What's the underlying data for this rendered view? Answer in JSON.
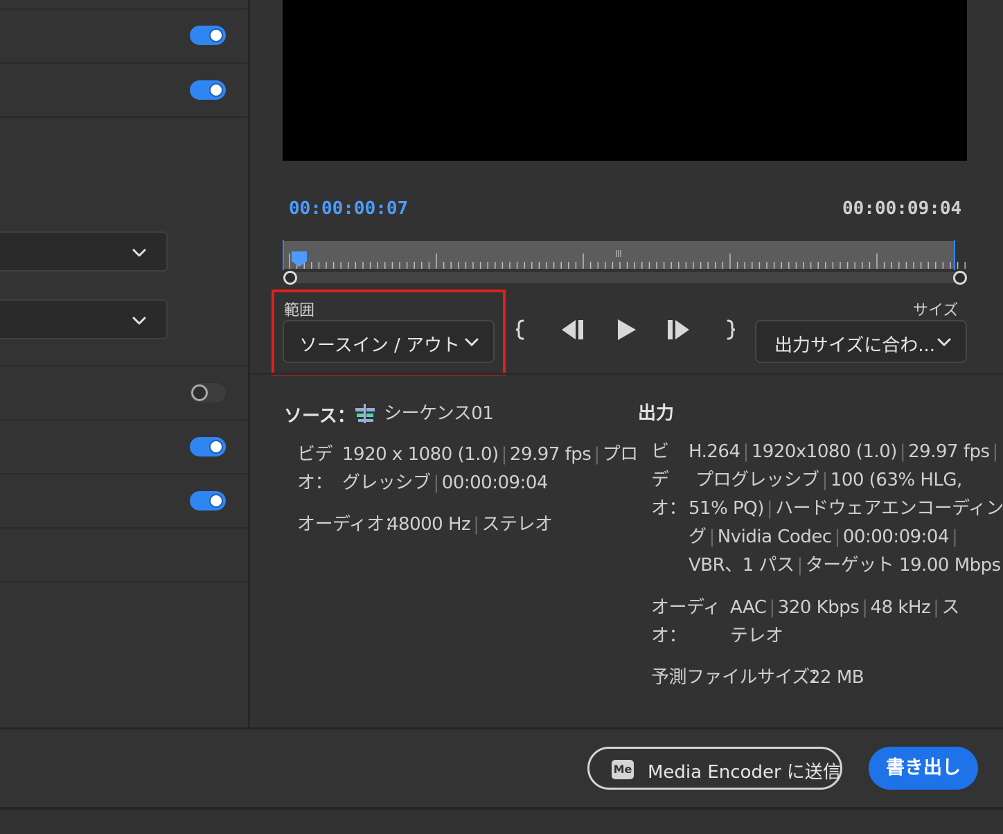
{
  "left_panel": {
    "toggles": [
      {
        "state": "on"
      },
      {
        "state": "on"
      },
      {
        "state": "off"
      },
      {
        "state": "on"
      },
      {
        "state": "on"
      }
    ]
  },
  "preview": {
    "current_timecode": "00:00:00:07",
    "duration_timecode": "00:00:09:04"
  },
  "range": {
    "label": "範囲",
    "selected": "ソースイン / アウト"
  },
  "size": {
    "label": "サイズ",
    "selected": "出力サイズに合わ..."
  },
  "source": {
    "title": "ソース：",
    "sequence_icon": "sequence-icon",
    "sequence_name": "シーケンス01",
    "video_label_line1": "ビデ",
    "video_label_line2": "オ：",
    "video_line1": "1920 x 1080 (1.0)",
    "video_line1b": "29.97 fps",
    "video_line1c": "プロ",
    "video_line2": "グレッシブ",
    "video_line2b": "00:00:09:04",
    "audio_label": "オーディオ：",
    "audio_value": "48000 Hz",
    "audio_value2": "ステレオ"
  },
  "output": {
    "title": "出力",
    "video_label_1": "ビ",
    "video_label_2": "デ",
    "video_label_3": "オ：",
    "video_l1a": "H.264",
    "video_l1b": "1920x1080 (1.0)",
    "video_l1c": "29.97 fps",
    "video_l2a": "プログレッシブ",
    "video_l2b": "100 (63% HLG,",
    "video_l3a": "51% PQ)",
    "video_l3b": "ハードウェアエンコーディン",
    "video_l4a": "グ",
    "video_l4b": "Nvidia Codec",
    "video_l4c": "00:00:09:04",
    "video_l5a": "VBR、1 パス",
    "video_l5b": "ターゲット 19.00 Mbps",
    "audio_label_1": "オーディ",
    "audio_label_2": "オ：",
    "audio_l1a": "AAC",
    "audio_l1b": "320 Kbps",
    "audio_l1c": "48 kHz",
    "audio_l1d": "ス",
    "audio_l2": "テレオ",
    "filesize_label": "予測ファイルサイズ：",
    "filesize_value": "22 MB"
  },
  "actions": {
    "me_badge": "Me",
    "send_label": "Media Encoder に送信",
    "export_label": "書き出し"
  },
  "colors": {
    "accent": "#2f86f2",
    "highlight": "#e0201c",
    "export": "#1e73e8"
  }
}
